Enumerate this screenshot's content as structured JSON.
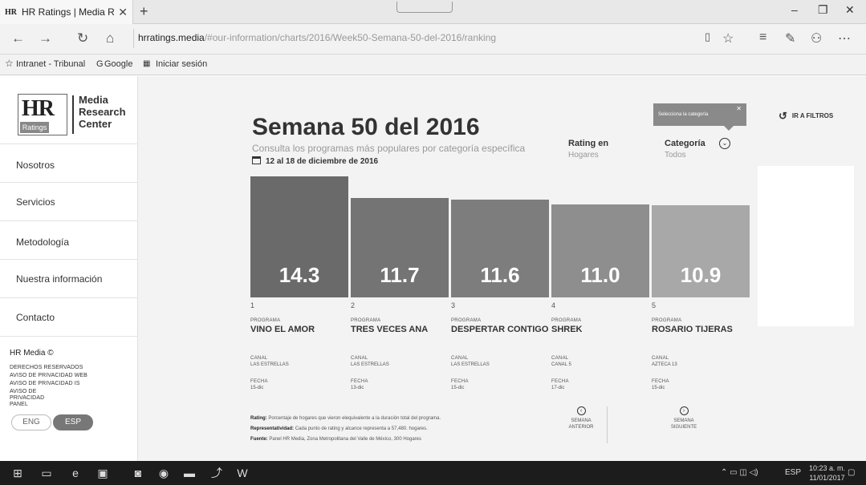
{
  "browser": {
    "tab_title": "HR Ratings | Media Rese",
    "tab_favicon": "HR",
    "url_host": "hrratings.media",
    "url_path": "/#our-information/charts/2016/Week50-Semana-50-del-2016/ranking",
    "favorites": [
      "Intranet - Tribunal",
      "Google",
      "Iniciar sesión"
    ]
  },
  "sidebar": {
    "logo": {
      "mark": "HR",
      "badge": "Ratings",
      "line1": "Media",
      "line2": "Research",
      "line3": "Center"
    },
    "menu": [
      "Nosotros",
      "Servicios",
      "Metodología",
      "Nuestra información",
      "Contacto"
    ],
    "footer_title": "HR Media ©",
    "footer_links": [
      "DERECHOS RESERVADOS",
      "AVISO DE PRIVACIDAD WEB",
      "AVISO DE PRIVACIDAD IS",
      "AVISO DE PRIVACIDAD PANEL"
    ],
    "lang_eng": "ENG",
    "lang_esp": "ESP"
  },
  "main": {
    "title": "Semana 50 del 2016",
    "subtitle": "Consulta los programas más populares por categoría específica",
    "dates": "12 al 18 de diciembre de 2016",
    "rating_label": "Rating en",
    "rating_value": "Hogares",
    "category_label": "Categoría",
    "category_value": "Todos",
    "tooltip": "Selecciona la categoría",
    "filters_link": "IR A FILTROS"
  },
  "chart_data": {
    "type": "bar",
    "categories": [
      "VINO EL AMOR",
      "TRES VECES ANA",
      "DESPERTAR CONTIGO",
      "SHREK",
      "ROSARIO TIJERAS"
    ],
    "values": [
      14.3,
      11.7,
      11.6,
      11.0,
      10.9
    ],
    "value_labels": [
      "14.3",
      "11.7",
      "11.6",
      "11.0",
      "10.9"
    ],
    "ranks": [
      "1",
      "2",
      "3",
      "4",
      "5"
    ],
    "channels": [
      "LAS ESTRELLAS",
      "LAS ESTRELLAS",
      "LAS ESTRELLAS",
      "CANAL 5",
      "AZTECA 13"
    ],
    "dates": [
      "15-dic",
      "13-dic",
      "15-dic",
      "17-dic",
      "15-dic"
    ],
    "label_program": "PROGRAMA",
    "label_channel": "CANAL",
    "label_date": "FECHA",
    "colors": [
      "#6a6a6a",
      "#747474",
      "#7d7d7d",
      "#8e8e8e",
      "#a8a8a8"
    ]
  },
  "legend": {
    "rating_key": "Rating:",
    "rating_text": "Porcentaje de hogares que vieron elequivalente a la duración total del programa.",
    "rep_key": "Representatividad:",
    "rep_text": "Cada punto de rating y alcance representa a 57,480. hogares.",
    "source_key": "Fuente:",
    "source_text": "Panel HR Media, Zona Metropolitana del Valle de México, 300 Hogares"
  },
  "week_nav": {
    "prev_line1": "SEMANA",
    "prev_line2": "ANTERIOR",
    "next_line1": "SEMANA",
    "next_line2": "SIGUIENTE"
  },
  "taskbar": {
    "lang": "ESP",
    "time": "10:23 a. m.",
    "date": "11/01/2017"
  }
}
